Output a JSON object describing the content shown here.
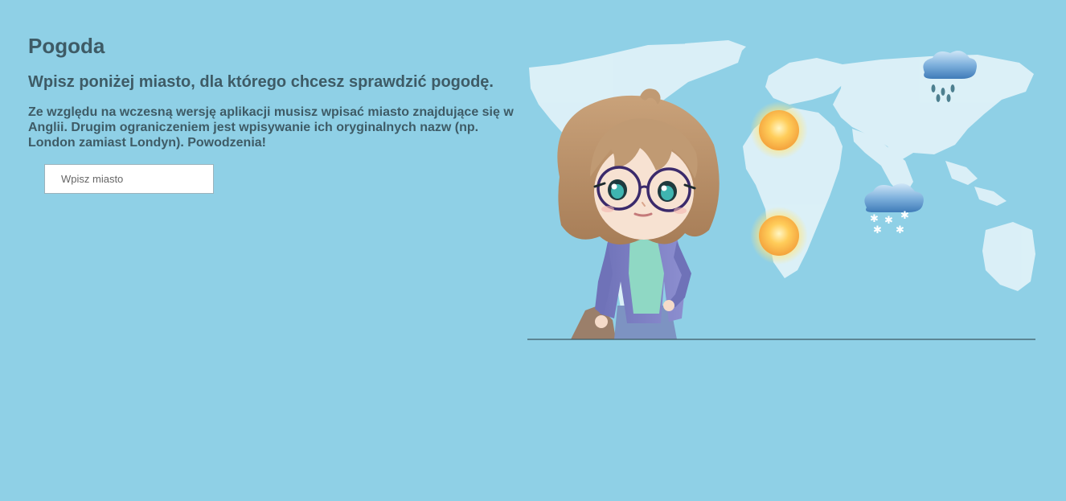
{
  "header": {
    "title": "Pogoda",
    "subtitle": "Wpisz poniżej miasto, dla którego chcesz sprawdzić pogodę.",
    "notice": "Ze względu na wczesną wersję aplikacji musisz wpisać miasto znajdujące się w Anglii. Drugim ograniczeniem jest wpisywanie ich oryginalnych nazw (np. London zamiast Londyn). Powodzenia!"
  },
  "search": {
    "placeholder": "Wpisz miasto",
    "value": ""
  },
  "illustration": {
    "icons": [
      "world-map",
      "girl-character",
      "sun-icon",
      "sun-icon",
      "rain-cloud-icon",
      "snow-cloud-icon"
    ]
  },
  "colors": {
    "background": "#8fd0e6",
    "text": "#3e5b66",
    "map": "#dff1f8"
  }
}
